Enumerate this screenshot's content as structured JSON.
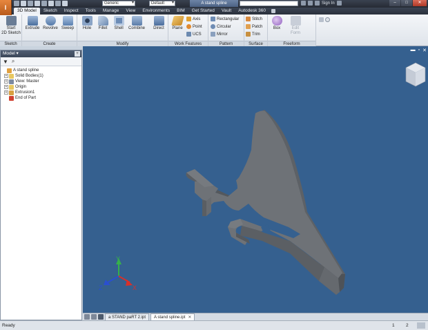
{
  "app": {
    "logo_letter": "I",
    "document_title": "A stand spline",
    "material_combo": "Generic",
    "appearance_combo": "Default",
    "sign_in": "Sign In",
    "help": "?"
  },
  "ribbon_tabs": [
    "3D Model",
    "Sketch",
    "Inspect",
    "Tools",
    "Manage",
    "View",
    "Environments",
    "BIM",
    "Get Started",
    "Vault",
    "Autodesk 360"
  ],
  "ribbon": {
    "sketch_panel": {
      "label": "Sketch",
      "start_sketch": "Start\n2D Sketch"
    },
    "create_panel": {
      "label": "Create",
      "extrude": "Extrude",
      "revolve": "Revolve",
      "sweep": "Sweep"
    },
    "modify_panel": {
      "label": "Modify",
      "hole": "Hole",
      "fillet": "Fillet",
      "shell": "Shell",
      "combine": "Combine",
      "direct": "Direct"
    },
    "work_features_panel": {
      "label": "Work Features",
      "plane": "Plane",
      "axis": "Axis",
      "point": "Point",
      "ucs": "UCS"
    },
    "pattern_panel": {
      "label": "Pattern",
      "rectangular": "Rectangular",
      "circular": "Circular",
      "mirror": "Mirror"
    },
    "surface_panel": {
      "label": "Surface",
      "stitch": "Stitch",
      "patch": "Patch",
      "trim": "Trim"
    },
    "freeform_panel": {
      "label": "Freeform",
      "box": "Box",
      "edit_form": "Edit\nForm"
    }
  },
  "browser": {
    "title": "Model",
    "tree": [
      {
        "label": "A stand spline",
        "indent": 0,
        "exp": "",
        "color": "#e0a040"
      },
      {
        "label": "Solid Bodies(1)",
        "indent": 1,
        "exp": "+",
        "color": "#e8c860"
      },
      {
        "label": "View: Master",
        "indent": 1,
        "exp": "+",
        "color": "#7c8aa0"
      },
      {
        "label": "Origin",
        "indent": 1,
        "exp": "+",
        "color": "#e8c860"
      },
      {
        "label": "Extrusion1",
        "indent": 1,
        "exp": "+",
        "color": "#d8a040"
      },
      {
        "label": "End of Part",
        "indent": 1,
        "exp": "",
        "color": "#d04030"
      }
    ]
  },
  "viewport": {
    "background": "#35608f",
    "axis_x": "X",
    "axis_y": "Y",
    "axis_z": "Z"
  },
  "doc_tabs": [
    {
      "label": "a STAND paRT 2.ipt",
      "active": false
    },
    {
      "label": "A stand spline.ipt",
      "active": true
    }
  ],
  "status": {
    "text": "Ready",
    "num1": "1",
    "num2": "2"
  }
}
